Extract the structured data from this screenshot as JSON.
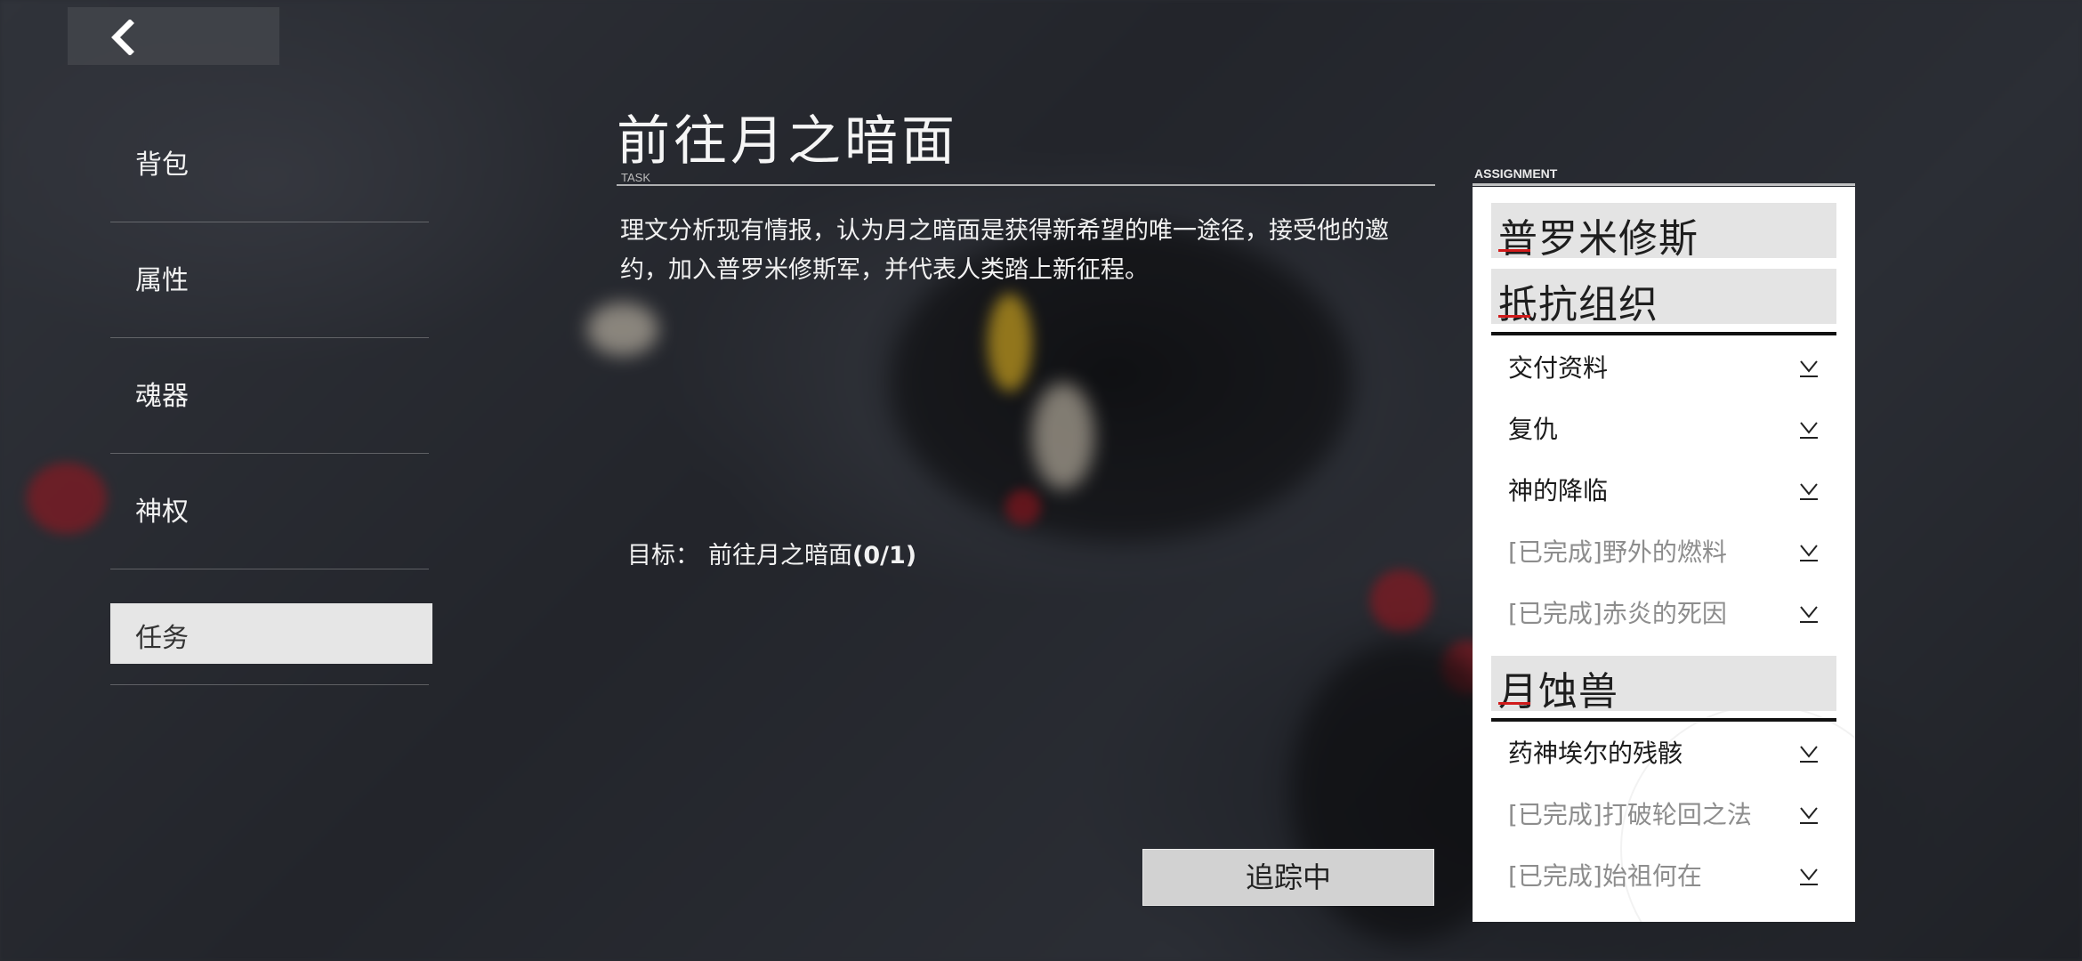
{
  "back": {
    "icon": "back-arrow-icon"
  },
  "menu": {
    "items": [
      {
        "label": "背包"
      },
      {
        "label": "属性"
      },
      {
        "label": "魂器"
      },
      {
        "label": "神权"
      },
      {
        "label": "任务"
      }
    ],
    "active_index": 4
  },
  "task": {
    "title": "前往月之暗面",
    "tag": "TASK",
    "description": "理文分析现有情报，认为月之暗面是获得新希望的唯一途径，接受他的邀约，加入普罗米修斯军，并代表人类踏上新征程。",
    "objective_label": "目标：",
    "objective_value": "前往月之暗面",
    "objective_progress": "(0/1)",
    "track_button": "追踪中"
  },
  "assignment": {
    "label": "ASSIGNMENT",
    "groups": [
      {
        "name": "普罗米修斯",
        "quests": []
      },
      {
        "name": "抵抗组织",
        "quests": [
          {
            "name": "交付资料",
            "completed": false
          },
          {
            "name": "复仇",
            "completed": false
          },
          {
            "name": "神的降临",
            "completed": false
          },
          {
            "name": "[已完成]野外的燃料",
            "completed": true
          },
          {
            "name": "[已完成]赤炎的死因",
            "completed": true
          }
        ]
      },
      {
        "name": "月蚀兽",
        "quests": [
          {
            "name": "药神埃尔的残骸",
            "completed": false
          },
          {
            "name": "[已完成]打破轮回之法",
            "completed": true
          },
          {
            "name": "[已完成]始祖何在",
            "completed": true
          }
        ]
      }
    ],
    "expand_icon": "expand-chevron-icon"
  },
  "colors": {
    "accent_red": "#d01a1a",
    "panel_bg": "#ffffff",
    "completed_text": "#8d8d8d"
  }
}
